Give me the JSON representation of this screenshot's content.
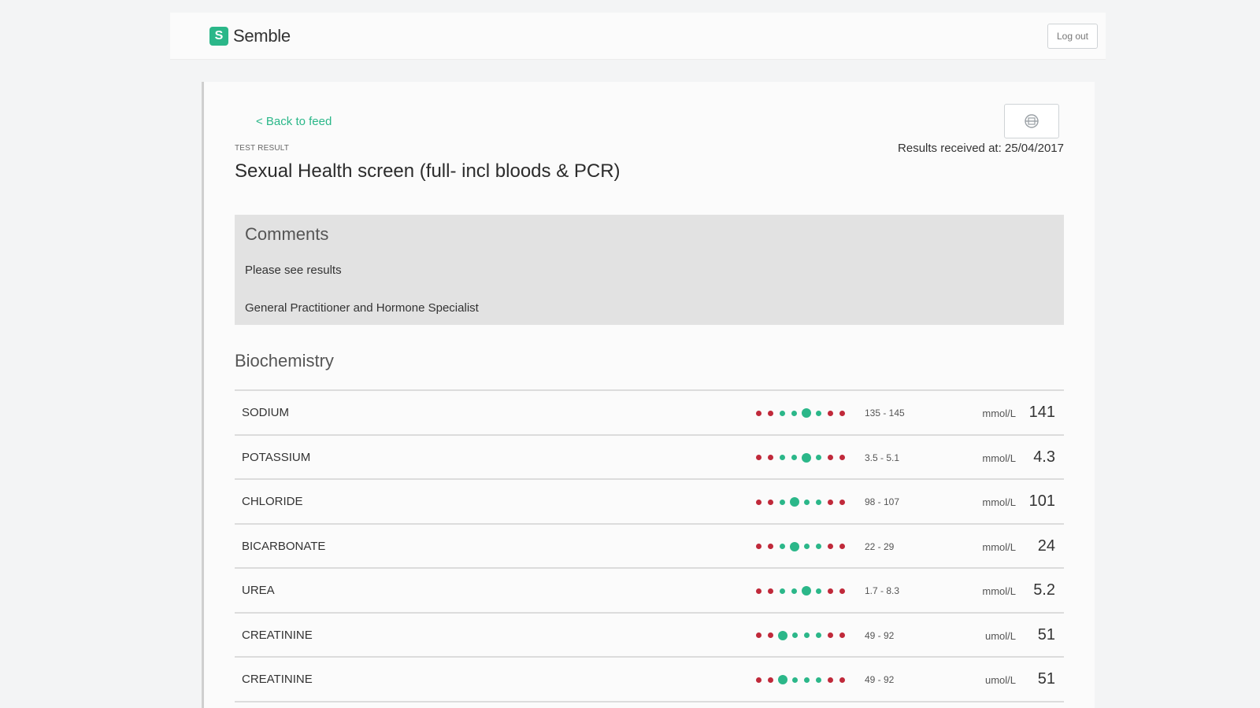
{
  "header": {
    "logo_mark": "S",
    "logo_text": "Semble",
    "logout_label": "Log out"
  },
  "result": {
    "back_label": "< Back to feed",
    "print_icon": "print-icon",
    "eyebrow": "TEST RESULT",
    "title": "Sexual Health screen (full- incl bloods & PCR)",
    "received_label": "Results received at:",
    "received_date": "25/04/2017"
  },
  "comments": {
    "title": "Comments",
    "line1": "Please see results",
    "line2": "General Practitioner and Hormone Specialist"
  },
  "section": {
    "title": "Biochemistry"
  },
  "colors": {
    "brand": "#2bb789",
    "out_of_range": "#c0293a"
  },
  "rows": [
    {
      "name": "SODIUM",
      "range": "135 - 145",
      "unit": "mmol/L",
      "value": "141",
      "dots": [
        "r",
        "r",
        "g",
        "g",
        "G",
        "g",
        "r",
        "r"
      ]
    },
    {
      "name": "POTASSIUM",
      "range": "3.5 - 5.1",
      "unit": "mmol/L",
      "value": "4.3",
      "dots": [
        "r",
        "r",
        "g",
        "g",
        "G",
        "g",
        "r",
        "r"
      ]
    },
    {
      "name": "CHLORIDE",
      "range": "98 - 107",
      "unit": "mmol/L",
      "value": "101",
      "dots": [
        "r",
        "r",
        "g",
        "G",
        "g",
        "g",
        "r",
        "r"
      ]
    },
    {
      "name": "BICARBONATE",
      "range": "22 - 29",
      "unit": "mmol/L",
      "value": "24",
      "dots": [
        "r",
        "r",
        "g",
        "G",
        "g",
        "g",
        "r",
        "r"
      ]
    },
    {
      "name": "UREA",
      "range": "1.7 - 8.3",
      "unit": "mmol/L",
      "value": "5.2",
      "dots": [
        "r",
        "r",
        "g",
        "g",
        "G",
        "g",
        "r",
        "r"
      ]
    },
    {
      "name": "CREATININE",
      "range": "49 - 92",
      "unit": "umol/L",
      "value": "51",
      "dots": [
        "r",
        "r",
        "G",
        "g",
        "g",
        "g",
        "r",
        "r"
      ]
    },
    {
      "name": "CREATININE",
      "range": "49 - 92",
      "unit": "umol/L",
      "value": "51",
      "dots": [
        "r",
        "r",
        "G",
        "g",
        "g",
        "g",
        "r",
        "r"
      ]
    }
  ]
}
